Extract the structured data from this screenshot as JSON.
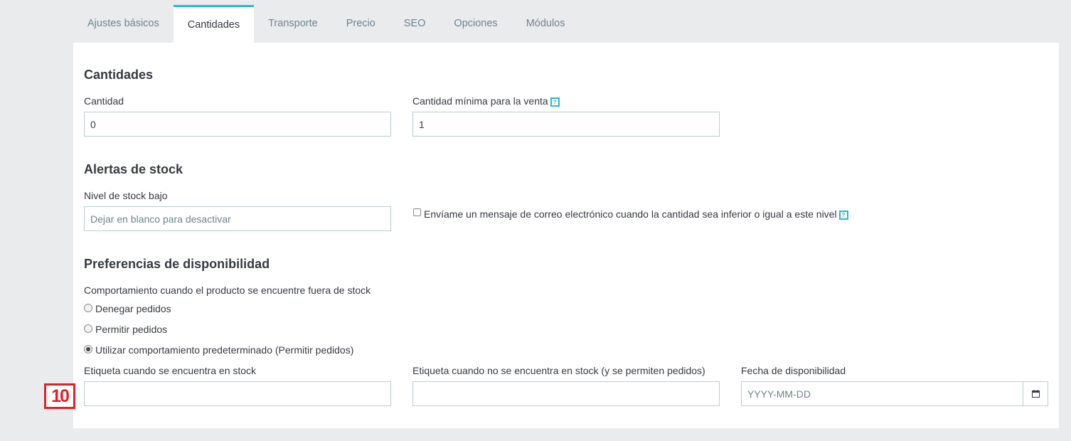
{
  "tabs": [
    {
      "label": "Ajustes básicos"
    },
    {
      "label": "Cantidades"
    },
    {
      "label": "Transporte"
    },
    {
      "label": "Precio"
    },
    {
      "label": "SEO"
    },
    {
      "label": "Opciones"
    },
    {
      "label": "Módulos"
    }
  ],
  "active_tab": "Cantidades",
  "sections": {
    "quantities": {
      "title": "Cantidades",
      "quantity_label": "Cantidad",
      "quantity_value": "0",
      "min_qty_label": "Cantidad mínima para la venta",
      "min_qty_value": "1"
    },
    "stock_alerts": {
      "title": "Alertas de stock",
      "low_stock_label": "Nivel de stock bajo",
      "low_stock_placeholder": "Dejar en blanco para desactivar",
      "email_alert_label": "Envíame un mensaje de correo electrónico cuando la cantidad sea inferior o igual a este nivel"
    },
    "availability": {
      "title": "Preferencias de disponibilidad",
      "behavior_label": "Comportamiento cuando el producto se encuentre fuera de stock",
      "options": [
        {
          "label": "Denegar pedidos",
          "selected": false
        },
        {
          "label": "Permitir pedidos",
          "selected": false
        },
        {
          "label": "Utilizar comportamiento predeterminado (Permitir pedidos)",
          "selected": true
        }
      ],
      "in_stock_label": "Etiqueta cuando se encuentra en stock",
      "out_stock_label": "Etiqueta cuando no se encuentra en stock (y se permiten pedidos)",
      "date_label": "Fecha de disponibilidad",
      "date_placeholder": "YYYY-MM-DD"
    }
  },
  "help_icon_text": "?",
  "annotation_badge": "10",
  "colors": {
    "accent": "#25b9d7",
    "badge": "#e0202a",
    "border": "#bbcdd2"
  }
}
